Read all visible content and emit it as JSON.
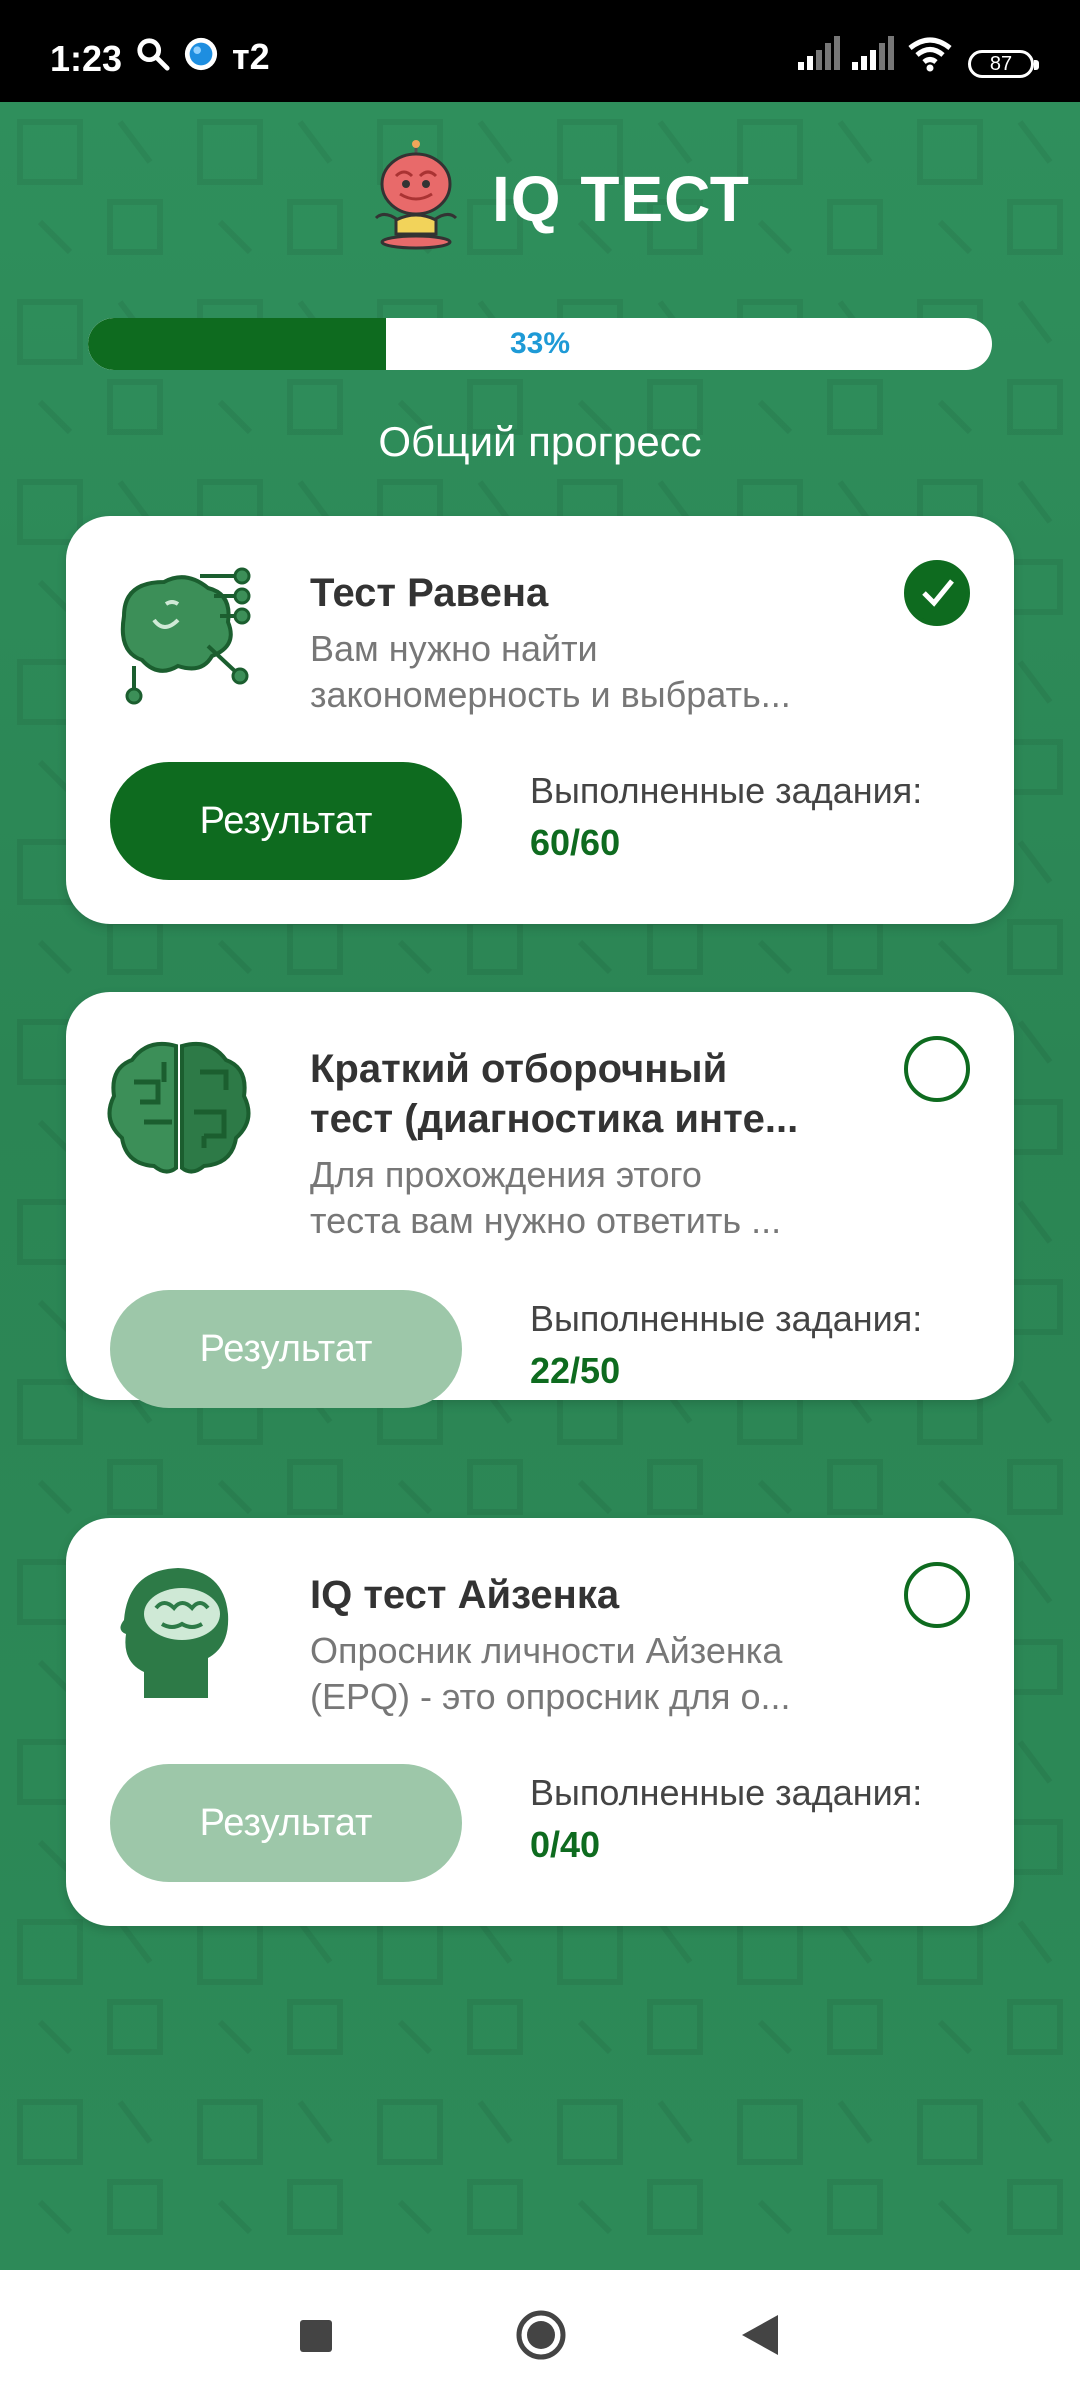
{
  "status_bar": {
    "time": "1:23",
    "carrier": "т2",
    "battery": "87",
    "icons": [
      "search-icon",
      "browser-icon",
      "signal-icon",
      "signal-icon",
      "wifi-icon",
      "battery-icon"
    ]
  },
  "app": {
    "title": "IQ ТЕСТ",
    "logo_icon": "brain-mascot-icon"
  },
  "progress": {
    "percent_text": "33%",
    "value": 0.33,
    "label": "Общий прогресс"
  },
  "colors": {
    "background": "#2e8b57",
    "accent": "#0e6b1f",
    "progress_text": "#1e9ad6",
    "disabled_button": "#9dc7a9"
  },
  "tests": [
    {
      "title": "Тест Равена",
      "description_line1": "Вам нужно найти",
      "description_line2": "закономерность и выбрать...",
      "completed": true,
      "button_label": "Результат",
      "button_enabled": true,
      "tasks_label": "Выполненные задания:",
      "tasks_value": "60/60",
      "icon": "brain-circuit-icon"
    },
    {
      "title_line1": "Краткий отборочный",
      "title_line2": "тест (диагностика инте...",
      "description_line1": "Для прохождения этого",
      "description_line2": "теста вам нужно ответить ...",
      "completed": false,
      "button_label": "Результат",
      "button_enabled": false,
      "tasks_label": "Выполненные задания:",
      "tasks_value": "22/50",
      "icon": "brain-maze-icon"
    },
    {
      "title": "IQ тест Айзенка",
      "description_line1": "Опросник личности Айзенка",
      "description_line2": "(EPQ) - это опросник для о...",
      "completed": false,
      "button_label": "Результат",
      "button_enabled": false,
      "tasks_label": "Выполненные задания:",
      "tasks_value": "0/40",
      "icon": "head-brain-icon"
    }
  ],
  "nav_bar": {
    "buttons": [
      "recents-icon",
      "home-icon",
      "back-icon"
    ]
  }
}
